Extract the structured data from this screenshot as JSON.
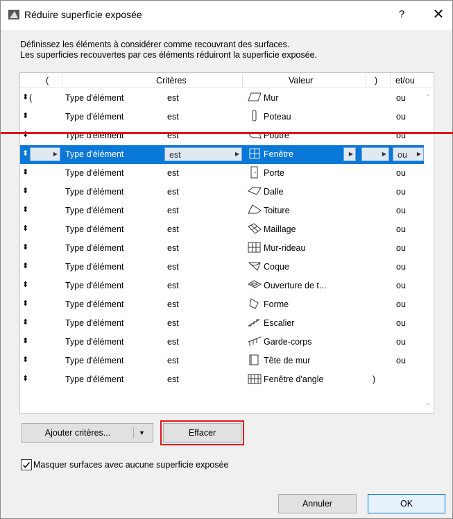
{
  "window": {
    "title": "Réduire superficie exposée",
    "help": "?",
    "close": "✕"
  },
  "description": {
    "line1": "Définissez les éléments à considérer comme recouvrant des surfaces.",
    "line2": "Les superficies recouvertes par ces éléments réduiront la superficie exposée."
  },
  "table": {
    "headers": {
      "open_paren": "(",
      "criteria": "Critères",
      "value": "Valeur",
      "close_paren": ")",
      "and_or": "et/ou"
    },
    "rows": [
      {
        "handle": "⬍",
        "open": "(",
        "type": "Type d'élément",
        "op": "est",
        "icon": "wall-icon",
        "value": "Mur",
        "close": "",
        "andor": "ou"
      },
      {
        "handle": "⬍",
        "open": "",
        "type": "Type d'élément",
        "op": "est",
        "icon": "column-icon",
        "value": "Poteau",
        "close": "",
        "andor": "ou"
      },
      {
        "handle": "⬍",
        "open": "",
        "type": "Type d'élément",
        "op": "est",
        "icon": "beam-icon",
        "value": "Poutre",
        "close": "",
        "andor": "ou"
      },
      {
        "handle": "⬍",
        "open": "",
        "type": "Type d'élément",
        "op": "est",
        "icon": "window-icon",
        "value": "Fenêtre",
        "close": "",
        "andor": "ou",
        "selected": true
      },
      {
        "handle": "⬍",
        "open": "",
        "type": "Type d'élément",
        "op": "est",
        "icon": "door-icon",
        "value": "Porte",
        "close": "",
        "andor": "ou"
      },
      {
        "handle": "⬍",
        "open": "",
        "type": "Type d'élément",
        "op": "est",
        "icon": "slab-icon",
        "value": "Dalle",
        "close": "",
        "andor": "ou"
      },
      {
        "handle": "⬍",
        "open": "",
        "type": "Type d'élément",
        "op": "est",
        "icon": "roof-icon",
        "value": "Toiture",
        "close": "",
        "andor": "ou"
      },
      {
        "handle": "⬍",
        "open": "",
        "type": "Type d'élément",
        "op": "est",
        "icon": "mesh-icon",
        "value": "Maillage",
        "close": "",
        "andor": "ou"
      },
      {
        "handle": "⬍",
        "open": "",
        "type": "Type d'élément",
        "op": "est",
        "icon": "curtain-wall-icon",
        "value": "Mur-rideau",
        "close": "",
        "andor": "ou"
      },
      {
        "handle": "⬍",
        "open": "",
        "type": "Type d'élément",
        "op": "est",
        "icon": "shell-icon",
        "value": "Coque",
        "close": "",
        "andor": "ou"
      },
      {
        "handle": "⬍",
        "open": "",
        "type": "Type d'élément",
        "op": "est",
        "icon": "opening-icon",
        "value": "Ouverture de t...",
        "close": "",
        "andor": "ou"
      },
      {
        "handle": "⬍",
        "open": "",
        "type": "Type d'élément",
        "op": "est",
        "icon": "morph-icon",
        "value": "Forme",
        "close": "",
        "andor": "ou"
      },
      {
        "handle": "⬍",
        "open": "",
        "type": "Type d'élément",
        "op": "est",
        "icon": "stair-icon",
        "value": "Escalier",
        "close": "",
        "andor": "ou"
      },
      {
        "handle": "⬍",
        "open": "",
        "type": "Type d'élément",
        "op": "est",
        "icon": "railing-icon",
        "value": "Garde-corps",
        "close": "",
        "andor": "ou"
      },
      {
        "handle": "⬍",
        "open": "",
        "type": "Type d'élément",
        "op": "est",
        "icon": "wall-end-icon",
        "value": "Tête de mur",
        "close": "",
        "andor": "ou"
      },
      {
        "handle": "⬍",
        "open": "",
        "type": "Type d'élément",
        "op": "est",
        "icon": "corner-window-icon",
        "value": "Fenêtre d'angle",
        "close": ")",
        "andor": ""
      }
    ]
  },
  "buttons": {
    "add_criteria": "Ajouter critères...",
    "clear": "Effacer",
    "cancel": "Annuler",
    "ok": "OK"
  },
  "checkbox": {
    "label": "Masquer surfaces avec aucune superficie exposée",
    "checked": true
  },
  "colors": {
    "selection": "#0a78d7",
    "highlight": "#e0141a"
  }
}
